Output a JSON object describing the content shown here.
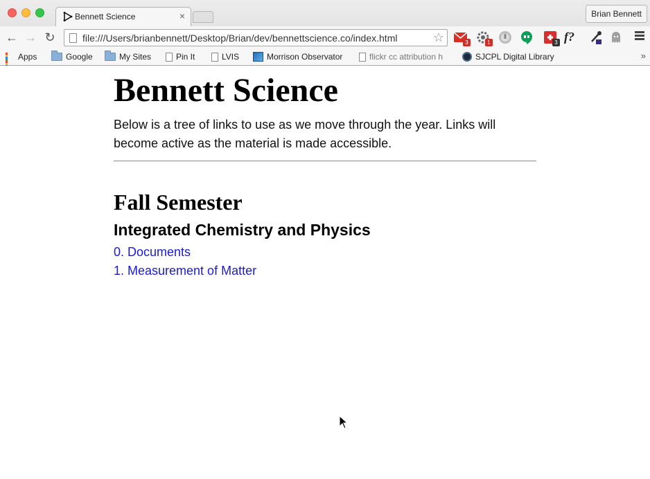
{
  "browser": {
    "tab_title": "Bennett Science",
    "tab_close": "×",
    "profile_name": "Brian Bennett",
    "url": "file:///Users/brianbennett/Desktop/Brian/dev/bennettscience.co/index.html",
    "extensions": [
      {
        "icon": "gmail-icon",
        "badge": "3"
      },
      {
        "icon": "gear-cluster-icon",
        "badge": "1"
      },
      {
        "icon": "disconnect-icon",
        "badge": ""
      },
      {
        "icon": "hangouts-icon",
        "badge": ""
      },
      {
        "icon": "puzzle-icon",
        "badge": "3"
      },
      {
        "icon": "formula-icon",
        "label": "f?"
      },
      {
        "icon": "eyedropper-icon",
        "badge": ""
      },
      {
        "icon": "ghostery-icon",
        "badge": ""
      }
    ],
    "bookmarks": [
      {
        "label": "Apps",
        "icon": "apps-icon"
      },
      {
        "label": "Google",
        "icon": "folder-icon"
      },
      {
        "label": "My Sites",
        "icon": "folder-icon"
      },
      {
        "label": "Pin It",
        "icon": "page-icon"
      },
      {
        "label": "LVIS",
        "icon": "page-icon"
      },
      {
        "label": "Morrison Observator",
        "icon": "image-icon"
      },
      {
        "label": "flickr cc attribution h",
        "icon": "page-icon"
      },
      {
        "label": "SJCPL Digital Library",
        "icon": "sjcpl-icon"
      }
    ],
    "bookmarks_more": "»"
  },
  "page": {
    "title": "Bennett Science",
    "intro": "Below is a tree of links to use as we move through the year. Links will become active as the material is made accessible.",
    "semester": "Fall Semester",
    "course": "Integrated Chemistry and Physics",
    "links": [
      "0. Documents",
      "1. Measurement of Matter"
    ]
  },
  "colors": {
    "link": "#1a1ad6",
    "traffic_close": "#fc605c",
    "traffic_min": "#fdbc40",
    "traffic_max": "#34c84a"
  }
}
